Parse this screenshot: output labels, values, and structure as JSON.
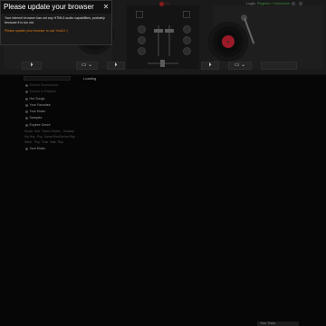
{
  "popup": {
    "title": "Please update your browser",
    "close_glyph": "✕",
    "message": "Your internet browser has not any HTML5 audio capabilities, probably because it is too old.",
    "link": "Please update your browser to use YouDJ :)"
  },
  "header": {
    "logo": "DJ",
    "login": "Login",
    "register": "Register / Subscribe"
  },
  "deck_controls": {
    "left": [
      "⏵",
      "▭ ⌄",
      "⏵"
    ],
    "right": [
      "⏵",
      "▭ ⌄"
    ]
  },
  "sidebar": {
    "items": [
      {
        "label": "Search Soundcloud",
        "dim": true
      },
      {
        "label": "Search in Playlists",
        "dim": true
      },
      {
        "label": "Hot Songs",
        "dim": false
      },
      {
        "label": "Your Favorites",
        "dim": false
      },
      {
        "label": "Your Music",
        "dim": false
      },
      {
        "label": "Samples",
        "dim": false
      },
      {
        "label": "Explore Genre",
        "dim": false
      },
      {
        "label": "Your Music",
        "dim": false
      }
    ],
    "genre_tags": [
      "House",
      "Dub",
      "Trance",
      "Electro",
      "Dubstep",
      "Hip-Hop",
      "Pop",
      "Dance",
      "Rock",
      "Techno",
      "Rap",
      "Metal",
      "Pop",
      "Funk",
      "Indie",
      "Rap"
    ]
  },
  "browser": {
    "loading": "Loading"
  },
  "footer": {
    "text": "Your Track"
  }
}
